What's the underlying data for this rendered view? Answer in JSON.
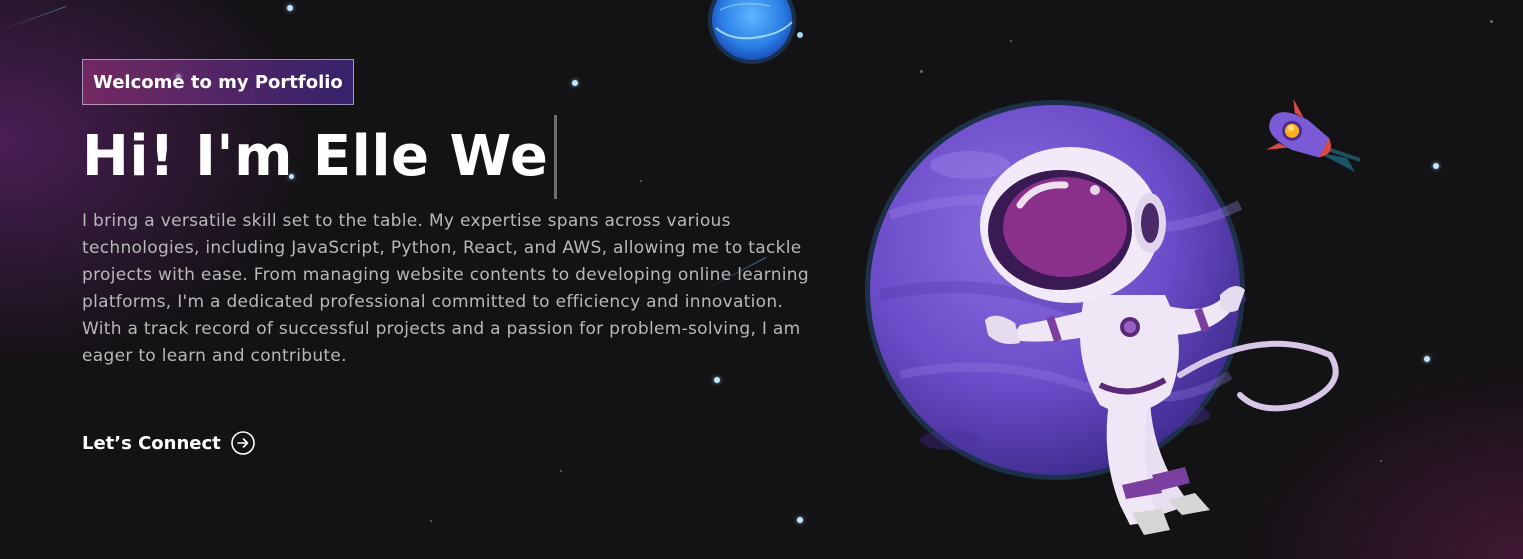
{
  "banner": {
    "tagline": "Welcome to my Portfolio",
    "headline": "Hi! I'm Elle We",
    "intro": "I bring a versatile skill set to the table. My expertise spans across various technologies, including JavaScript, Python, React, and AWS, allowing me to tackle projects with ease. From managing website contents to developing online learning platforms, I'm a dedicated professional committed to efficiency and innovation. With a track record of successful projects and a passion for problem-solving, I am eager to learn and contribute.",
    "connect_label": "Let’s Connect",
    "connect_icon": "arrow-right-circle-icon"
  },
  "illustration": {
    "subject": "astronaut-floating-icon",
    "planet": "purple-planet-icon",
    "moon": "blue-moon-icon",
    "rocket": "rocket-icon"
  },
  "colors": {
    "background": "#121212",
    "text": "#ffffff",
    "body_text": "#b8b8b8",
    "tagline_gradient_start": "#aa367c",
    "tagline_gradient_end": "#4a2fbd",
    "planet": "#6b4bc8",
    "suit": "#e9dff2",
    "visor": "#8b2f8c"
  }
}
